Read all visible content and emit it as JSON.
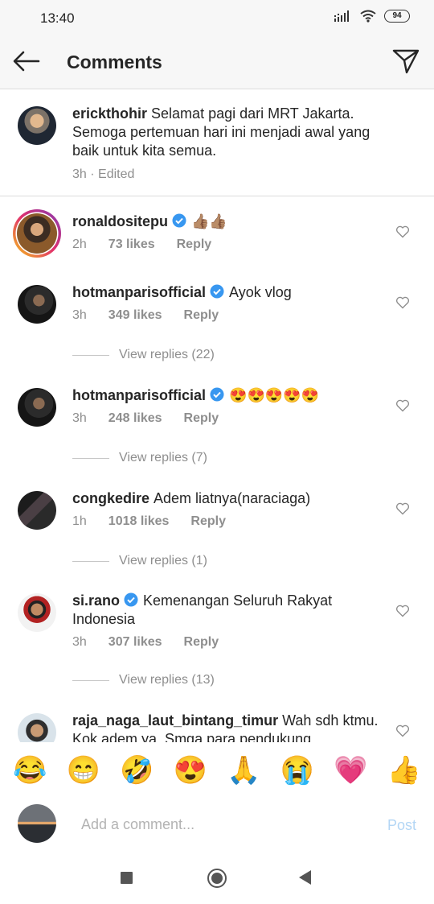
{
  "status": {
    "time": "13:40",
    "battery": "94"
  },
  "header": {
    "title": "Comments"
  },
  "caption": {
    "username": "erickthohir",
    "text": "Selamat pagi dari MRT Jakarta. Semoga pertemuan hari ini menjadi awal yang baik untuk kita semua.",
    "meta": "3h · Edited"
  },
  "comments": [
    {
      "username": "ronaldositepu",
      "verified": true,
      "text": "👍🏽👍🏽",
      "time": "2h",
      "likes": "73 likes",
      "reply": "Reply"
    },
    {
      "username": "hotmanparisofficial",
      "verified": true,
      "text": "Ayok vlog",
      "time": "3h",
      "likes": "349 likes",
      "reply": "Reply",
      "view_replies": "View replies (22)"
    },
    {
      "username": "hotmanparisofficial",
      "verified": true,
      "text": "😍😍😍😍😍",
      "time": "3h",
      "likes": "248 likes",
      "reply": "Reply",
      "view_replies": "View replies (7)"
    },
    {
      "username": "congkedire",
      "verified": false,
      "text": "Adem liatnya(naraciaga)",
      "time": "1h",
      "likes": "1018 likes",
      "reply": "Reply",
      "view_replies": "View replies (1)"
    },
    {
      "username": "si.rano",
      "verified": true,
      "text": "Kemenangan Seluruh Rakyat Indonesia",
      "time": "3h",
      "likes": "307 likes",
      "reply": "Reply",
      "view_replies": "View replies (13)"
    },
    {
      "username": "raja_naga_laut_bintang_timur",
      "verified": false,
      "text": "Wah sdh ktmu. Kok adem ya. Smga para pendukung"
    }
  ],
  "emojis": [
    "😂",
    "😁",
    "🤣",
    "😍",
    "🙏",
    "😭",
    "💗",
    "👍"
  ],
  "composer": {
    "placeholder": "Add a comment...",
    "post_label": "Post"
  },
  "colors": {
    "verified": "#3897f0",
    "post_disabled": "#b3d6f5",
    "muted": "#8e8e8e"
  }
}
